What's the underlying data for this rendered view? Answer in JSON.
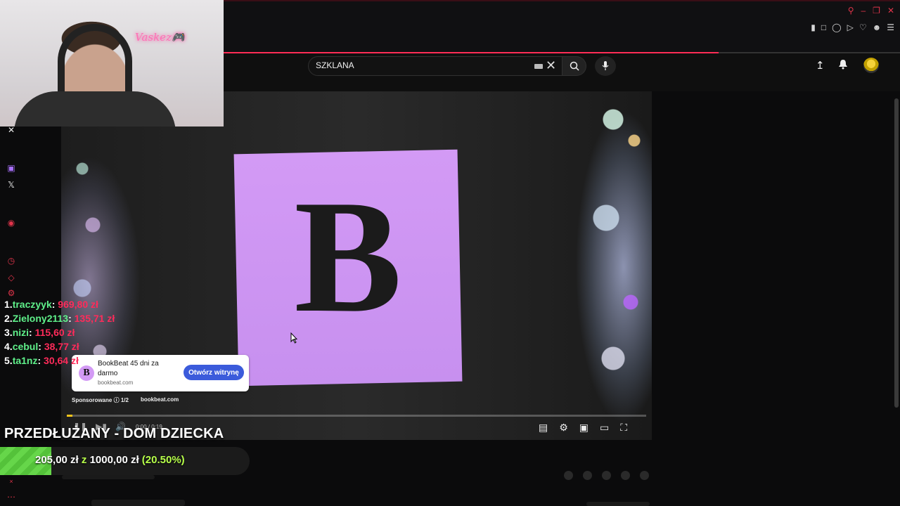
{
  "search": {
    "query": "SZKLANA"
  },
  "ad": {
    "title": "BookBeat 45 dni za darmo",
    "domain": "bookbeat.com",
    "cta": "Otwórz witrynę",
    "sponsored": "Sponsorowane",
    "counter": "1/2",
    "site": "bookbeat.com",
    "logo_letter": "B"
  },
  "video": {
    "letter": "B",
    "time": "0:00 / 0:19",
    "progress_fraction": 0.01
  },
  "webcam": {
    "sign": "Vaskez🎮"
  },
  "donors": [
    {
      "rank": "1.",
      "name": "traczyyk",
      "amount": "969,80 zł"
    },
    {
      "rank": "2.",
      "name": "Zielony2113",
      "amount": "135,71 zł"
    },
    {
      "rank": "3.",
      "name": "nizi",
      "amount": "115,60 zł"
    },
    {
      "rank": "4.",
      "name": "cebul",
      "amount": "38,77 zł"
    },
    {
      "rank": "5.",
      "name": "ta1nz",
      "amount": "30,64 zł"
    }
  ],
  "goal": {
    "title": "PRZEDŁUŻANY - DOM DZIECKA",
    "current": "205,00 zł",
    "connector": "z",
    "target": "1000,00 zł",
    "percent": "(20.50%)",
    "fraction": 0.205
  },
  "colors": {
    "accent": "#e0344a",
    "donor_name": "#5ff08a",
    "donor_amount": "#ff2b5a",
    "goal_fill": "#54c23a",
    "video_card": "#d39af5"
  }
}
